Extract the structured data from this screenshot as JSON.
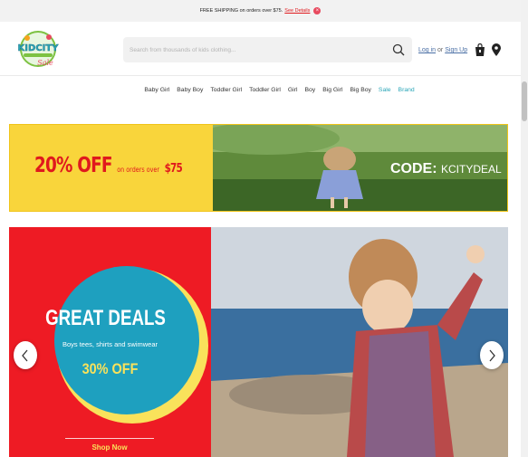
{
  "promo_bar": {
    "text": "FREE SHIPPING on orders over $75.",
    "link": "See Details",
    "close": "×"
  },
  "header": {
    "logo_text": "KIDCITY",
    "logo_sub": "Sale",
    "search_placeholder": "Search from thousands of kids clothing...",
    "login": "Log in",
    "or": "or",
    "signup": "Sign Up"
  },
  "nav": {
    "items": [
      "Baby Girl",
      "Baby Boy",
      "Toddler Girl",
      "Toddler Girl",
      "Girl",
      "Boy",
      "Big Girl",
      "Big Boy",
      "Sale",
      "Brand"
    ]
  },
  "banner": {
    "off": "20% OFF",
    "on_orders": "on orders over",
    "amount": "$75",
    "code_label": "CODE:",
    "code_value": "KCITYDEAL"
  },
  "hero": {
    "title": "GREAT DEALS",
    "subtitle": "Boys tees, shirts and swimwear",
    "percent": "30% OFF",
    "cta": "Shop Now"
  },
  "colors": {
    "accent_red": "#e0191d",
    "yellow": "#f9d53b",
    "teal": "#1ea0bf",
    "nav_teal": "#2aa6b8"
  }
}
